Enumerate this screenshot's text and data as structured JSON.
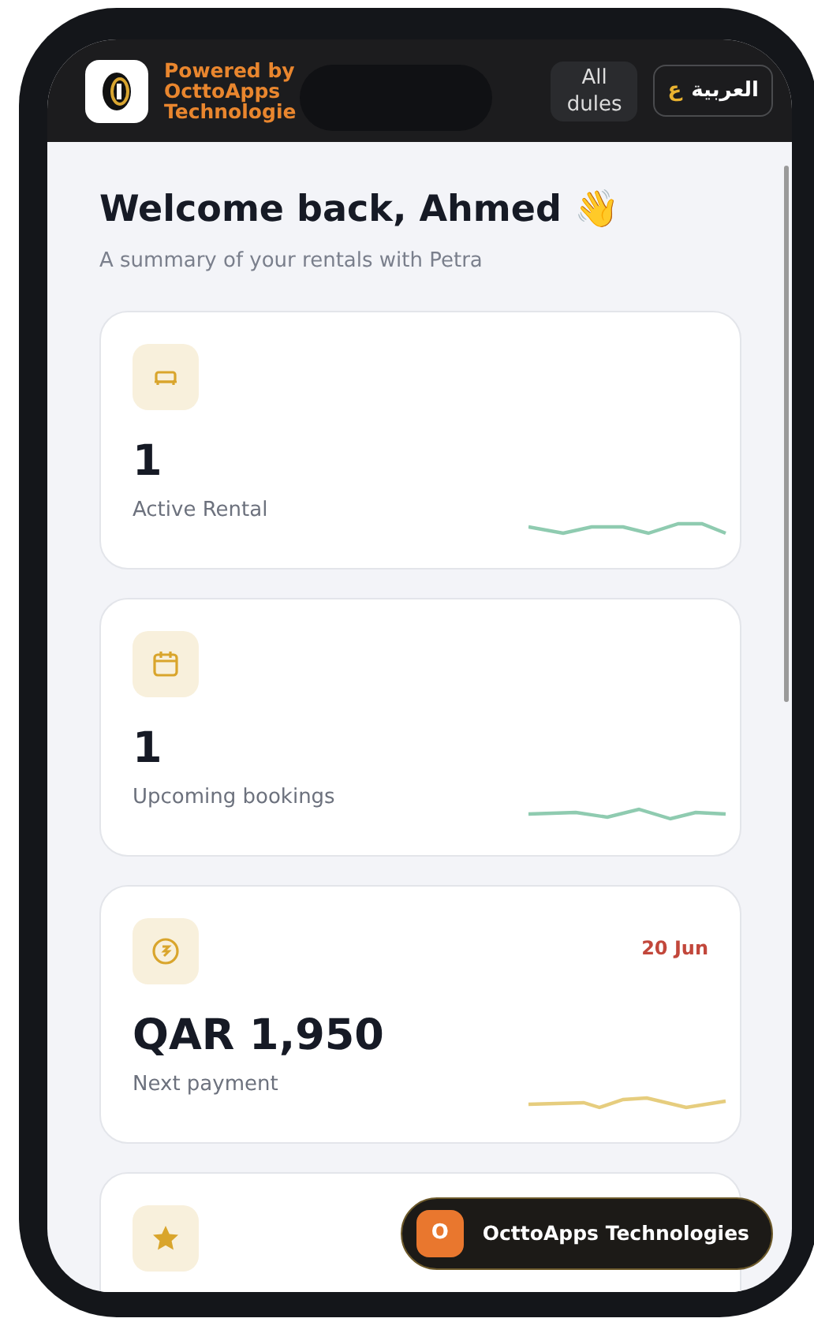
{
  "header": {
    "brand_lines": [
      "Powered by",
      "OcttoApps",
      "Technologie"
    ],
    "modules_button": [
      "All",
      "dules"
    ],
    "language_button": {
      "label": "العربية",
      "glyph": "ع"
    }
  },
  "greeting": {
    "title": "Welcome back, Ahmed 👋",
    "subtitle": "A summary of your rentals with Petra"
  },
  "cards": [
    {
      "kind": "stat",
      "value": "1",
      "label": "Active Rental",
      "color": "#8fcbb0"
    },
    {
      "kind": "stat",
      "value": "1",
      "label": "Upcoming bookings",
      "color": "#8fcbb0"
    },
    {
      "kind": "stat",
      "value": "QAR 1,950",
      "label": "Next payment",
      "date": "20 Jun",
      "color": "#e6cd7e"
    },
    {
      "kind": "partial"
    }
  ],
  "floating_badge": {
    "glyph": "O",
    "label": "OcttoApps Technologies"
  }
}
